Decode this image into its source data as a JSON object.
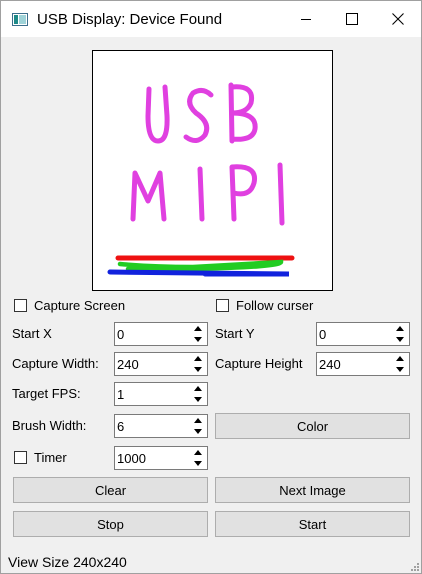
{
  "window": {
    "title": "USB Display: Device Found"
  },
  "canvas": {
    "drawing_letters": "USB MIPI",
    "colors": {
      "letters": "#e040e0",
      "red": "#ee1111",
      "green": "#22cc22",
      "blue": "#1122dd"
    }
  },
  "options": {
    "capture_screen_label": "Capture Screen",
    "capture_screen_checked": false,
    "follow_curser_label": "Follow curser",
    "follow_curser_checked": false
  },
  "fields": {
    "start_x": {
      "label": "Start X",
      "value": "0"
    },
    "start_y": {
      "label": "Start Y",
      "value": "0"
    },
    "capture_width": {
      "label": "Capture Width:",
      "value": "240"
    },
    "capture_height": {
      "label": "Capture Height",
      "value": "240"
    },
    "target_fps": {
      "label": "Target FPS:",
      "value": "1"
    },
    "brush_width": {
      "label": "Brush Width:",
      "value": "6"
    },
    "timer": {
      "label": "Timer",
      "value": "1000",
      "checked": false
    }
  },
  "buttons": {
    "color": "Color",
    "clear": "Clear",
    "next_image": "Next Image",
    "stop": "Stop",
    "start": "Start"
  },
  "status": {
    "text": "View Size 240x240"
  }
}
